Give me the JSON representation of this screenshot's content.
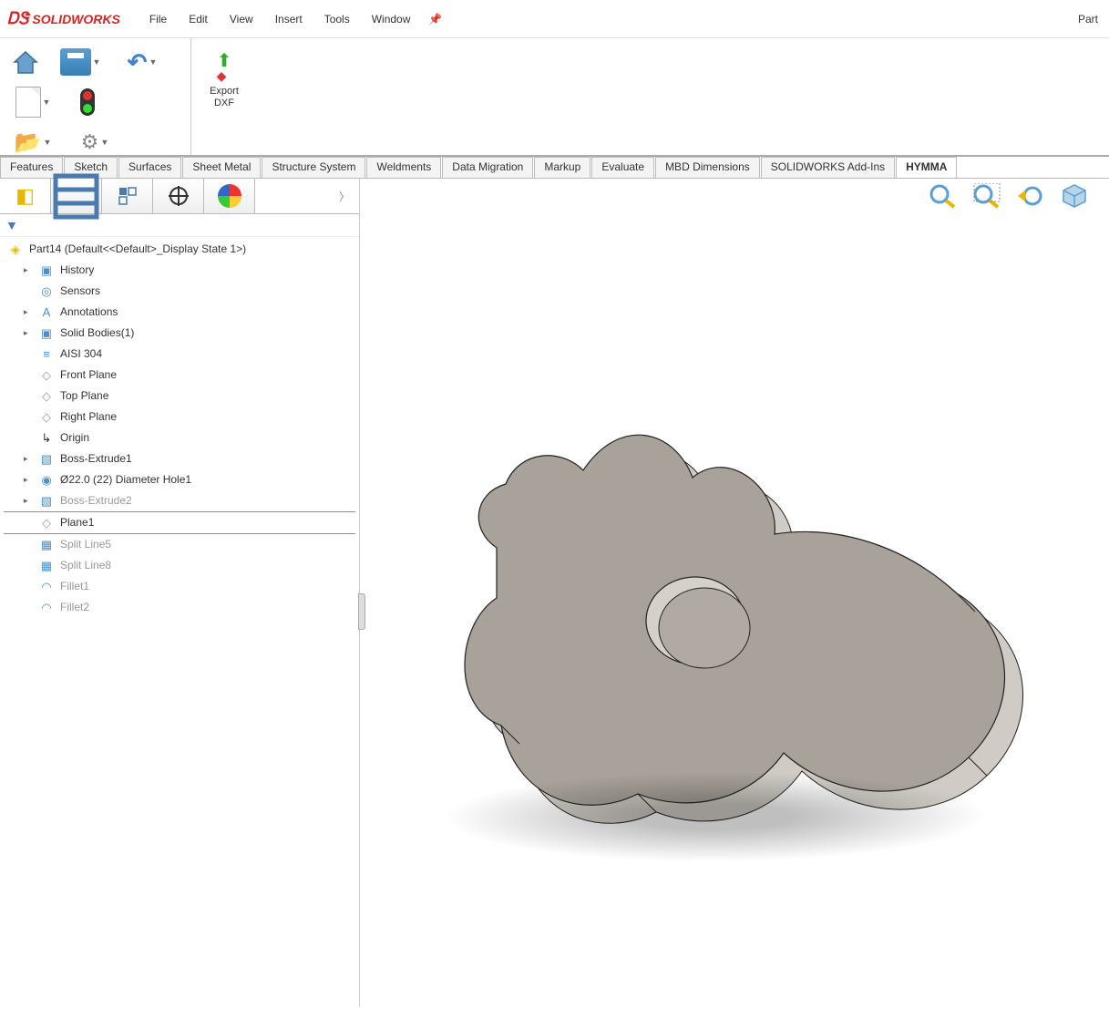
{
  "app": {
    "name": "SOLIDWORKS",
    "doc_title": "Part"
  },
  "menu": {
    "file": "File",
    "edit": "Edit",
    "view": "View",
    "insert": "Insert",
    "tools": "Tools",
    "window": "Window"
  },
  "toolbar": {
    "export_line1": "Export",
    "export_line2": "DXF"
  },
  "cmd_tabs": [
    "Features",
    "Sketch",
    "Surfaces",
    "Sheet Metal",
    "Structure System",
    "Weldments",
    "Data Migration",
    "Markup",
    "Evaluate",
    "MBD Dimensions",
    "SOLIDWORKS Add-Ins",
    "HYMMA"
  ],
  "cmd_tabs_active": "HYMMA",
  "tree": {
    "root": "Part14  (Default<<Default>_Display State 1>)",
    "items": [
      {
        "label": "History",
        "icon": "folder",
        "expand": true
      },
      {
        "label": "Sensors",
        "icon": "sensor",
        "expand": false
      },
      {
        "label": "Annotations",
        "icon": "annot",
        "expand": true
      },
      {
        "label": "Solid Bodies(1)",
        "icon": "solid",
        "expand": true
      },
      {
        "label": "AISI 304",
        "icon": "material",
        "expand": false
      },
      {
        "label": "Front Plane",
        "icon": "plane",
        "expand": false
      },
      {
        "label": "Top Plane",
        "icon": "plane",
        "expand": false
      },
      {
        "label": "Right Plane",
        "icon": "plane",
        "expand": false
      },
      {
        "label": "Origin",
        "icon": "origin",
        "expand": false
      },
      {
        "label": "Boss-Extrude1",
        "icon": "extrude",
        "expand": true
      },
      {
        "label": "Ø22.0 (22) Diameter Hole1",
        "icon": "hole",
        "expand": true
      },
      {
        "label": "Boss-Extrude2",
        "icon": "extrude",
        "expand": true,
        "suppressed": true
      },
      {
        "label": "Plane1",
        "icon": "plane",
        "expand": false,
        "selected": true
      },
      {
        "label": "Split Line5",
        "icon": "split",
        "expand": false,
        "suppressed": true
      },
      {
        "label": "Split Line8",
        "icon": "split",
        "expand": false,
        "suppressed": true
      },
      {
        "label": "Fillet1",
        "icon": "fillet",
        "expand": false,
        "suppressed": true
      },
      {
        "label": "Fillet2",
        "icon": "fillet",
        "expand": false,
        "suppressed": true
      }
    ]
  }
}
